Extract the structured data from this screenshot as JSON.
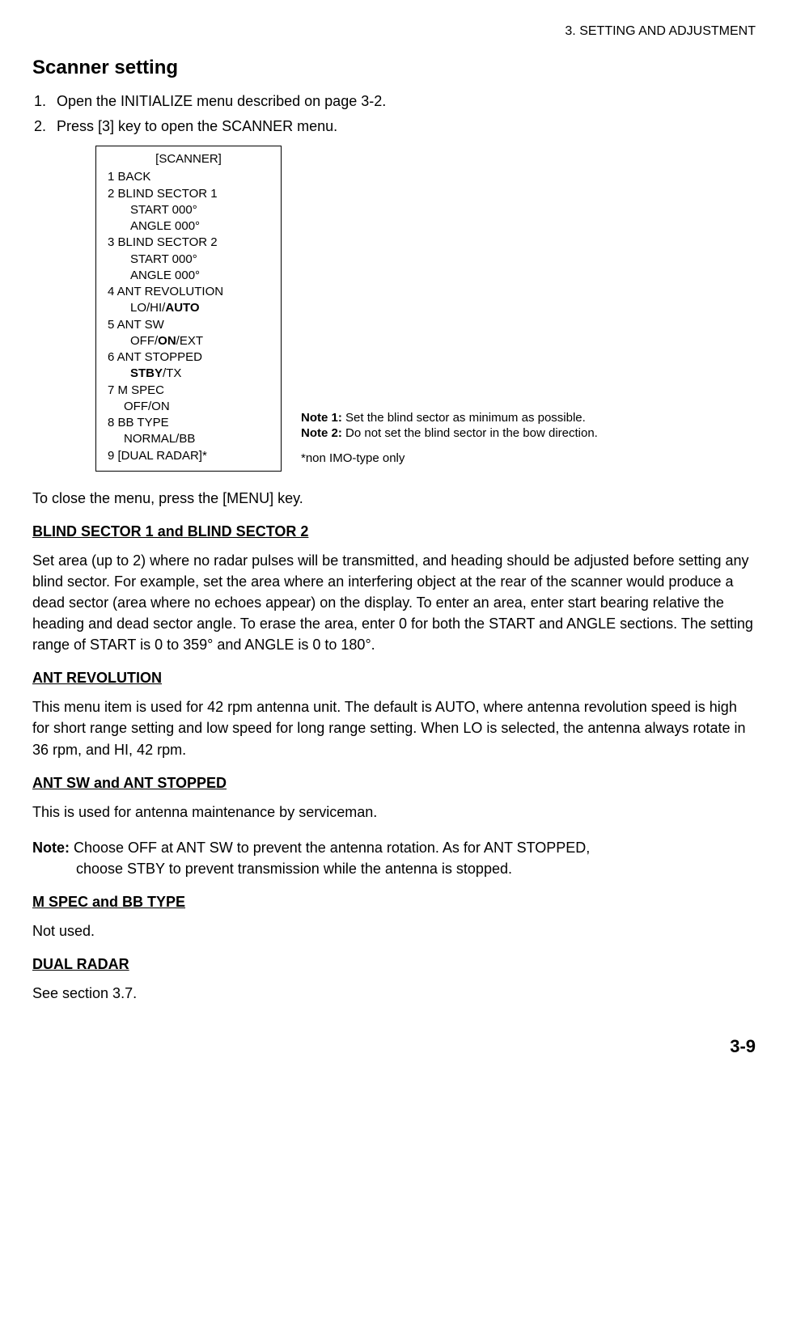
{
  "header": "3. SETTING AND ADJUSTMENT",
  "title": "Scanner setting",
  "steps": [
    "Open the INITIALIZE menu described on page 3-2.",
    "Press [3] key to open the SCANNER menu."
  ],
  "menu": {
    "title": "[SCANNER]",
    "items": {
      "l1": "1  BACK",
      "l2": "2  BLIND SECTOR 1",
      "l2a": "START 000°",
      "l2b": "ANGLE 000°",
      "l3": "3  BLIND SECTOR 2",
      "l3a": "START 000°",
      "l3b": "ANGLE 000°",
      "l4": "4  ANT REVOLUTION",
      "l4a_pre": "LO/HI/",
      "l4a_bold": "AUTO",
      "l5": "5  ANT SW",
      "l5a_pre": "OFF/",
      "l5a_bold": "ON",
      "l5a_post": "/EXT",
      "l6": "6  ANT STOPPED",
      "l6a_bold": "STBY",
      "l6a_post": "/TX",
      "l7": "7  M SPEC",
      "l7a": "OFF/ON",
      "l8": "8  BB TYPE",
      "l8a": "NORMAL/BB",
      "l9": "9  [DUAL RADAR]*"
    }
  },
  "side": {
    "n1_label": "Note 1:",
    "n1_text": " Set the blind sector as minimum as possible.",
    "n2_label": "Note 2:",
    "n2_text": " Do not set the blind sector in the bow direction.",
    "footnote": "*non IMO-type only"
  },
  "close_text": "To close the menu, press the [MENU] key.",
  "sections": {
    "blind_title": "BLIND SECTOR 1 and BLIND SECTOR 2",
    "blind_body": "Set area (up to 2) where no radar pulses will be transmitted, and heading should be adjusted before setting any blind sector. For example, set the area where an interfering object at the rear of the scanner would produce a dead sector (area where no echoes appear) on the display. To enter an area, enter start bearing relative the heading and dead sector angle. To erase the area, enter 0 for both the START and ANGLE sections. The setting range of START is 0 to 359° and ANGLE is 0 to 180°.",
    "antrev_title": "ANT REVOLUTION",
    "antrev_body": "This menu item is used for 42 rpm antenna unit. The default is AUTO, where antenna revolution speed is high for short range setting and low speed for long range setting. When LO is selected, the antenna always rotate in 36 rpm, and HI, 42 rpm.",
    "antsw_title": "ANT SW and ANT STOPPED",
    "antsw_body": "This is used for antenna maintenance by serviceman.",
    "note_label": "Note:",
    "note_line1": " Choose OFF at ANT SW to prevent the antenna rotation. As for ANT STOPPED,",
    "note_line2": "choose STBY to prevent transmission while the antenna is stopped.",
    "mspec_title": "M SPEC and BB TYPE",
    "mspec_body": "Not used.",
    "dual_title": "DUAL RADAR",
    "dual_body": "See section 3.7."
  },
  "page_number": "3-9"
}
